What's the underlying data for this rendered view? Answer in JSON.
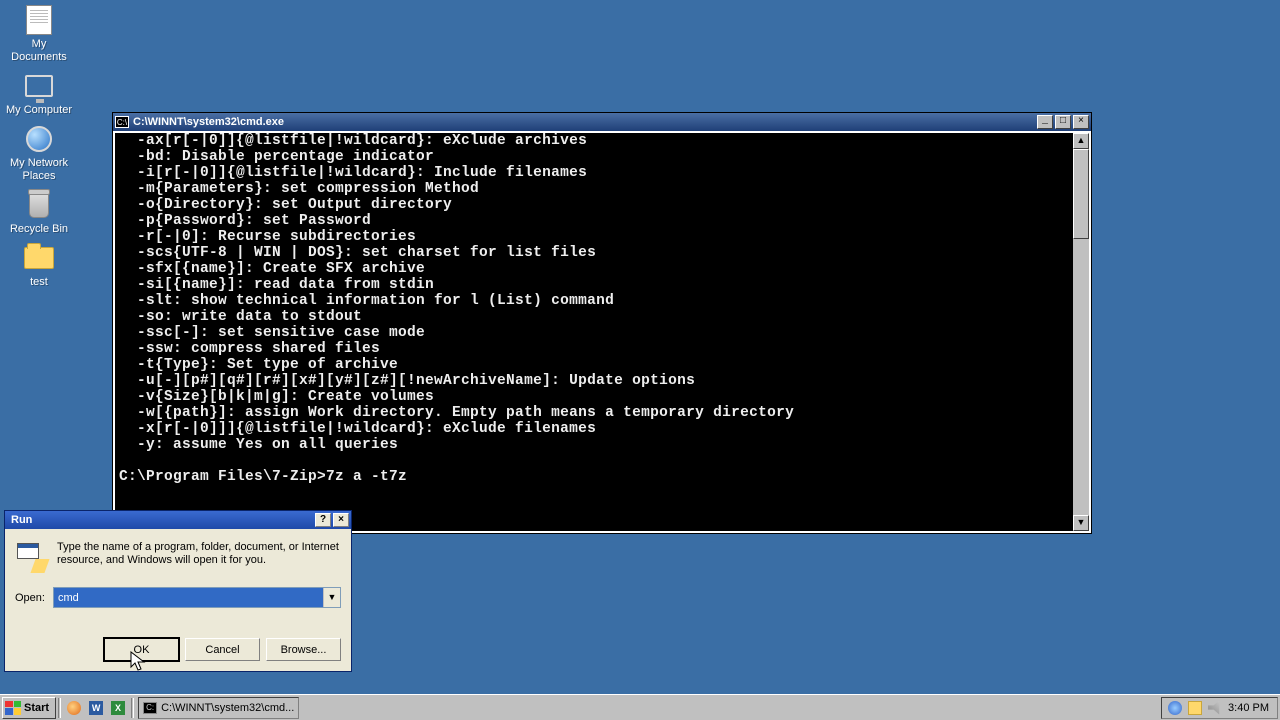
{
  "desktop": {
    "icons": [
      {
        "label": "My Documents",
        "kind": "doc"
      },
      {
        "label": "My Computer",
        "kind": "monitor"
      },
      {
        "label": "My Network Places",
        "kind": "globe"
      },
      {
        "label": "Recycle Bin",
        "kind": "bin"
      },
      {
        "label": "test",
        "kind": "folder"
      }
    ]
  },
  "cmd": {
    "title": "C:\\WINNT\\system32\\cmd.exe",
    "lines": [
      "  -ax[r[-|0]]{@listfile|!wildcard}: eXclude archives",
      "  -bd: Disable percentage indicator",
      "  -i[r[-|0]]{@listfile|!wildcard}: Include filenames",
      "  -m{Parameters}: set compression Method",
      "  -o{Directory}: set Output directory",
      "  -p{Password}: set Password",
      "  -r[-|0]: Recurse subdirectories",
      "  -scs{UTF-8 | WIN | DOS}: set charset for list files",
      "  -sfx[{name}]: Create SFX archive",
      "  -si[{name}]: read data from stdin",
      "  -slt: show technical information for l (List) command",
      "  -so: write data to stdout",
      "  -ssc[-]: set sensitive case mode",
      "  -ssw: compress shared files",
      "  -t{Type}: Set type of archive",
      "  -u[-][p#][q#][r#][x#][y#][z#][!newArchiveName]: Update options",
      "  -v{Size}[b|k|m|g]: Create volumes",
      "  -w[{path}]: assign Work directory. Empty path means a temporary directory",
      "  -x[r[-|0]]]{@listfile|!wildcard}: eXclude filenames",
      "  -y: assume Yes on all queries",
      "",
      "C:\\Program Files\\7-Zip>7z a -t7z"
    ]
  },
  "run": {
    "title": "Run",
    "desc": "Type the name of a program, folder, document, or Internet resource, and Windows will open it for you.",
    "open_label": "Open:",
    "open_value": "cmd",
    "buttons": {
      "ok": "OK",
      "cancel": "Cancel",
      "browse": "Browse..."
    }
  },
  "taskbar": {
    "start": "Start",
    "task_button": "C:\\WINNT\\system32\\cmd...",
    "clock": "3:40 PM"
  }
}
